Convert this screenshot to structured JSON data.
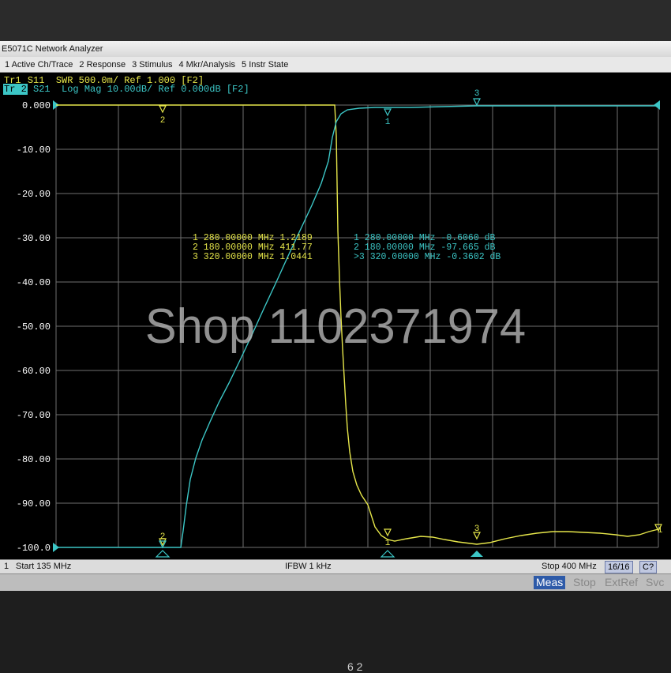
{
  "window": {
    "title": "E5071C Network Analyzer"
  },
  "menu": [
    "1 Active Ch/Trace",
    "2 Response",
    "3 Stimulus",
    "4 Mkr/Analysis",
    "5 Instr State"
  ],
  "traces": {
    "tr1": {
      "tag": "Tr1",
      "text": "S11  SWR 500.0m/ Ref 1.000 [F2]",
      "color": "#e6e64a"
    },
    "tr2": {
      "tag": "Tr 2",
      "text": "S21  Log Mag 10.00dB/ Ref 0.000dB [F2]",
      "color": "#3cc6c6"
    }
  },
  "axis": {
    "y_ticks": [
      "0.000",
      "-10.00",
      "-20.00",
      "-30.00",
      "-40.00",
      "-50.00",
      "-60.00",
      "-70.00",
      "-80.00",
      "-90.00",
      "-100.0"
    ]
  },
  "marker_table": {
    "tr1_rows": [
      "1   280.00000 MHz  1.2189",
      "2   180.00000 MHz  411.77",
      "3   320.00000 MHz  1.0441"
    ],
    "tr2_rows": [
      "1   280.00000 MHz -0.6060 dB",
      "2   180.00000 MHz -97.665  dB",
      ">3  320.00000 MHz -0.3602 dB"
    ]
  },
  "marker_labels": [
    "1",
    "2",
    "3"
  ],
  "status": {
    "channel": "1",
    "start": "Start 135 MHz",
    "ifbw": "IFBW 1 kHz",
    "stop": "Stop 400 MHz",
    "points": "16/16",
    "cal": "C?"
  },
  "softkeys": [
    "Meas",
    "Stop",
    "ExtRef",
    "Svc"
  ],
  "watermark": "Shop 1102371974",
  "footer_glyph": "6 2"
}
